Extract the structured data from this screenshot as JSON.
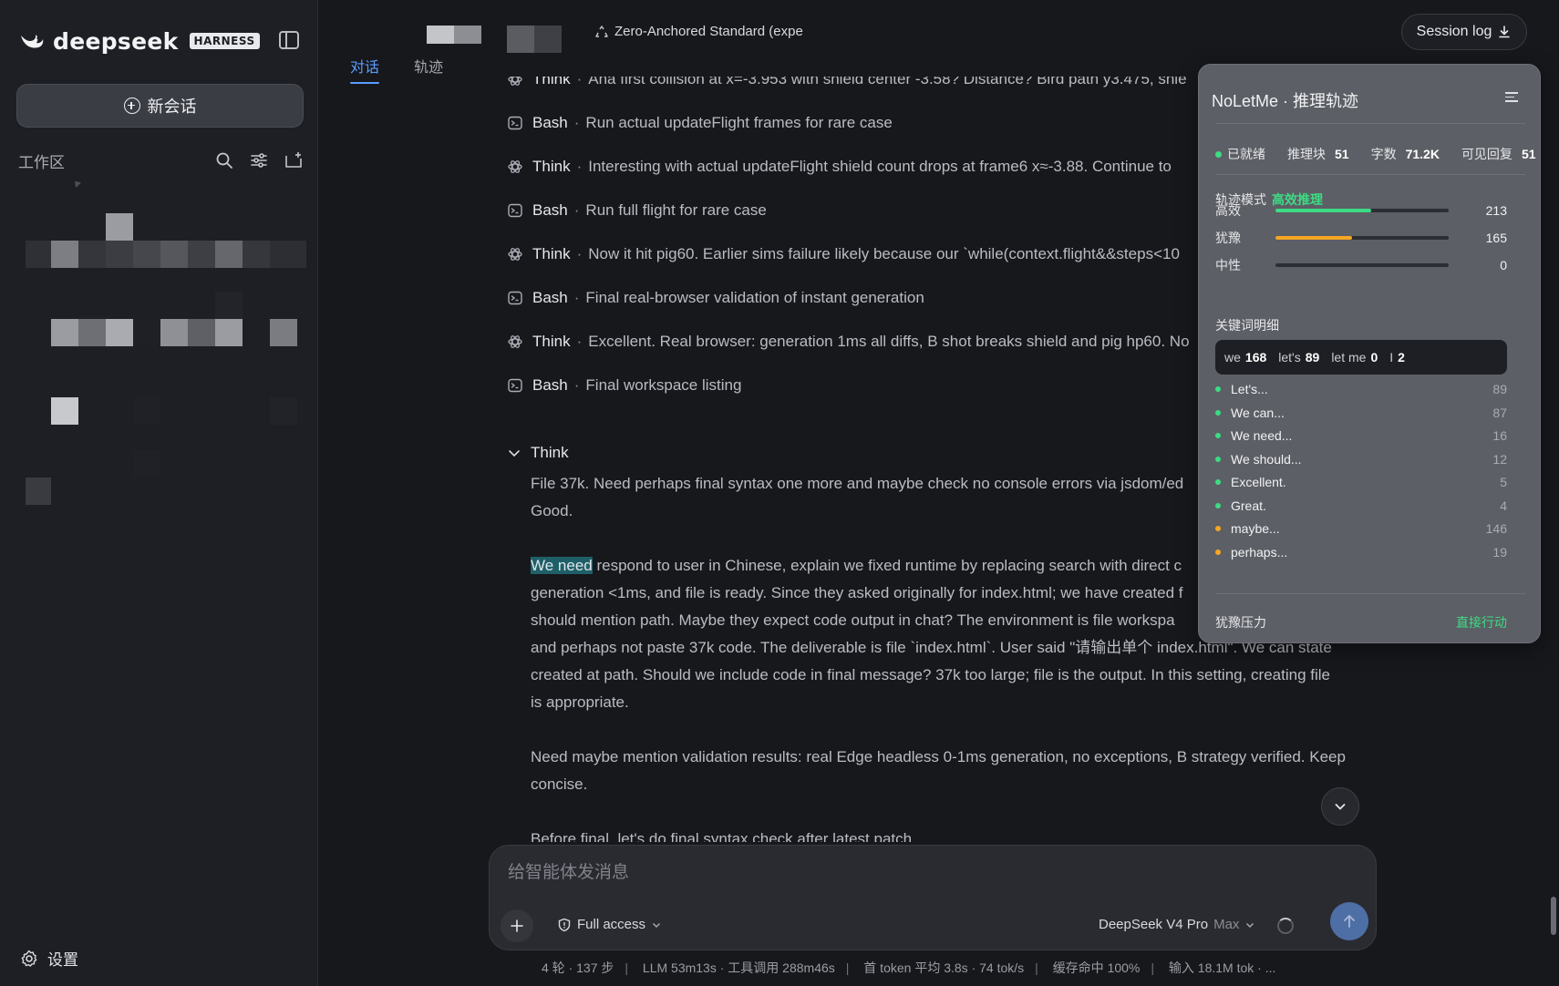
{
  "brand": {
    "name": "deepseek",
    "badge": "HARNESS"
  },
  "sidebar": {
    "new_chat": "新会话",
    "workspace_label": "工作区",
    "settings_label": "设置"
  },
  "header": {
    "document_title": "Zero-Anchored Standard (expe",
    "tabs": [
      {
        "label": "对话",
        "active": true
      },
      {
        "label": "轨迹",
        "active": false
      }
    ],
    "session_log": "Session log"
  },
  "steps": [
    {
      "kind": "Think",
      "text": "Ana first collision at x=-3.953 with shield center -3.58? Distance? Bird path y3.475, shie",
      "icon": "think-icon"
    },
    {
      "kind": "Bash",
      "text": "Run actual updateFlight frames for rare case",
      "icon": "terminal-icon"
    },
    {
      "kind": "Think",
      "text": "Interesting with actual updateFlight shield count drops at frame6 x≈-3.88. Continue to",
      "icon": "think-icon"
    },
    {
      "kind": "Bash",
      "text": "Run full flight for rare case",
      "icon": "terminal-icon"
    },
    {
      "kind": "Think",
      "text": "Now it hit pig60. Earlier sims failure likely because our `while(context.flight&&steps<10",
      "icon": "think-icon"
    },
    {
      "kind": "Bash",
      "text": "Final real-browser validation of instant generation",
      "icon": "terminal-icon"
    },
    {
      "kind": "Think",
      "text": "Excellent. Real browser: generation 1ms all diffs, B shot breaks shield and pig hp60. No",
      "icon": "think-icon"
    },
    {
      "kind": "Bash",
      "text": "Final workspace listing",
      "icon": "terminal-icon"
    }
  ],
  "think_open": {
    "label": "Think",
    "p1": [
      "File 37k. Need perhaps final syntax one more and maybe check no console errors via jsdom/ed",
      "Good."
    ],
    "p2_highlight": "We need",
    "p2_first_rest": " respond to user in Chinese, explain we fixed runtime by replacing search with direct c",
    "p2_lines": [
      "generation <1ms, and file is ready. Since they asked originally for index.html; we have created f",
      "should mention path. Maybe they expect code output in chat? The environment is file workspa",
      "and perhaps not paste 37k code. The deliverable is file `index.html`. User said \"请输出单个 index.html\". We can state",
      "created at path. Should we include code in final message? 37k too large; file is the output. In this setting, creating file",
      "is appropriate."
    ],
    "p3": [
      "Need maybe mention validation results: real Edge headless 0-1ms generation, no exceptions, B strategy verified. Keep",
      "concise."
    ],
    "p4": "Before final, let's do final syntax check after latest patch"
  },
  "composer": {
    "placeholder": "给智能体发消息",
    "access": "Full access",
    "model": "DeepSeek V4 Pro",
    "model_mode": "Max"
  },
  "stats": [
    "4 轮 · 137 步",
    "LLM 53m13s · 工具调用 288m46s",
    "首 token 平均 3.8s · 74 tok/s",
    "缓存命中 100%",
    "输入 18.1M tok · ..."
  ],
  "panel": {
    "title": "NoLetMe · 推理轨迹",
    "status": "已就绪",
    "blocks_label": "推理块",
    "blocks": "51",
    "chars_label": "字数",
    "chars": "71.2K",
    "replies_label": "可见回复",
    "replies": "51",
    "mode_label": "轨迹模式",
    "mode_value": "高效推理",
    "bars": [
      {
        "label": "高效",
        "value": "213",
        "fraction": 0.55,
        "color": "#3ddc84"
      },
      {
        "label": "犹豫",
        "value": "165",
        "fraction": 0.44,
        "color": "#f5a623"
      },
      {
        "label": "中性",
        "value": "0",
        "fraction": 0,
        "color": "#9aa0a6"
      }
    ],
    "keywords_title": "关键词明细",
    "keywords": [
      {
        "k": "we",
        "v": "168"
      },
      {
        "k": "let's",
        "v": "89"
      },
      {
        "k": "let me",
        "v": "0"
      },
      {
        "k": "I",
        "v": "2"
      }
    ],
    "phrases": [
      {
        "text": "Let's...",
        "count": "89",
        "color": "#3ddc84"
      },
      {
        "text": "We can...",
        "count": "87",
        "color": "#3ddc84"
      },
      {
        "text": "We need...",
        "count": "16",
        "color": "#3ddc84"
      },
      {
        "text": "We should...",
        "count": "12",
        "color": "#3ddc84"
      },
      {
        "text": "Excellent.",
        "count": "5",
        "color": "#3ddc84"
      },
      {
        "text": "Great.",
        "count": "4",
        "color": "#3ddc84"
      },
      {
        "text": "maybe...",
        "count": "146",
        "color": "#f5a623"
      },
      {
        "text": "perhaps...",
        "count": "19",
        "color": "#f5a623"
      }
    ],
    "pressure_label": "犹豫压力",
    "pressure_value": "直接行动"
  }
}
